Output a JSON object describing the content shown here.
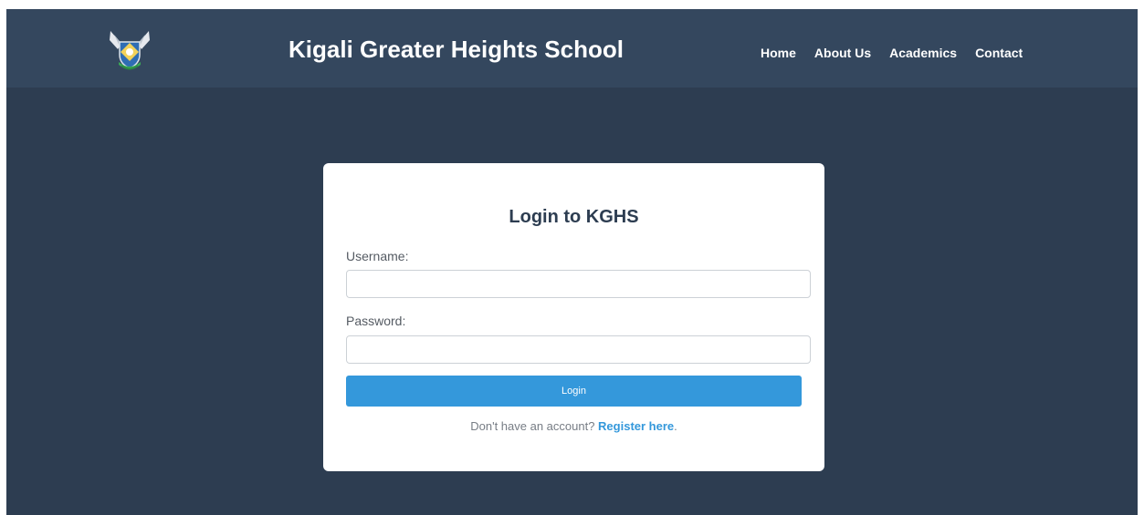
{
  "header": {
    "site_title": "Kigali Greater Heights School",
    "logo_icon": "school-crest-icon",
    "nav": [
      {
        "label": "Home"
      },
      {
        "label": "About Us"
      },
      {
        "label": "Academics"
      },
      {
        "label": "Contact"
      }
    ]
  },
  "login": {
    "title": "Login to KGHS",
    "username_label": "Username:",
    "username_value": "",
    "password_label": "Password:",
    "password_value": "",
    "submit_label": "Login",
    "register_prompt": "Don't have an account? ",
    "register_link": "Register here",
    "register_suffix": "."
  },
  "colors": {
    "header_bg": "#34475e",
    "page_bg": "#2d3d51",
    "accent": "#3498db",
    "card_bg": "#ffffff"
  }
}
